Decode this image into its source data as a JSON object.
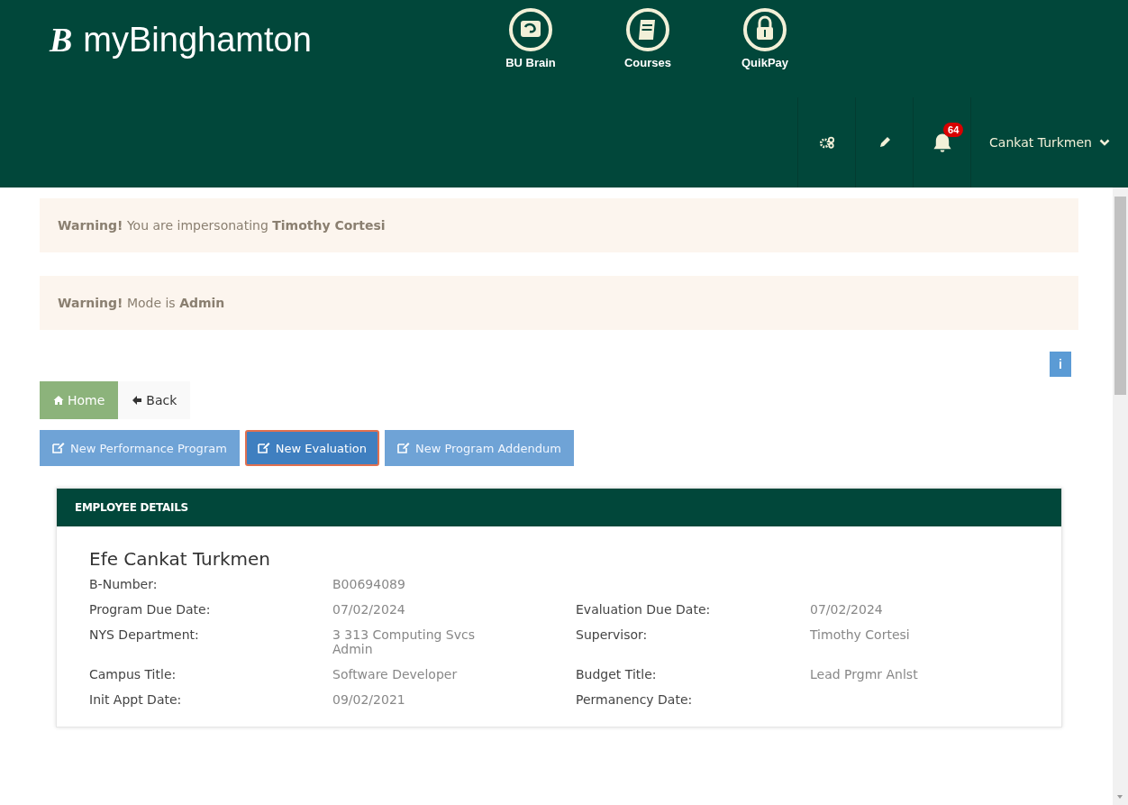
{
  "header": {
    "logo_letter": "B",
    "site_name": "myBinghamton",
    "quick_links": [
      {
        "label": "BU Brain",
        "kind": "brain"
      },
      {
        "label": "Courses",
        "kind": "book"
      },
      {
        "label": "QuikPay",
        "kind": "lock"
      }
    ],
    "notification_count": "64",
    "user_name": "Cankat Turkmen"
  },
  "alerts": [
    {
      "text": "**Warning!** You are impersonating **Timothy Cortesi**"
    },
    {
      "text": "**Warning!** Mode is **Admin**"
    }
  ],
  "info_button": "i",
  "nav_buttons": [
    {
      "label": "Home",
      "kind": "home"
    },
    {
      "label": "Back",
      "kind": "back"
    }
  ],
  "action_buttons": [
    {
      "label": "New Performance Program",
      "selected": false
    },
    {
      "label": "New Evaluation",
      "selected": true
    },
    {
      "label": "New Program Addendum",
      "selected": false
    }
  ],
  "panel": {
    "title": "EMPLOYEE DETAILS",
    "employee_name": "Efe Cankat Turkmen",
    "rows": [
      [
        {
          "label": "B-Number:",
          "value": "B00694089"
        }
      ],
      [
        {
          "label": "Program Due Date:",
          "value": "07/02/2024"
        },
        {
          "label": "Evaluation Due Date:",
          "value": "07/02/2024"
        }
      ],
      [
        {
          "label": "NYS Department:",
          "value": "3 313 Computing Svcs Admin"
        },
        {
          "label": "Supervisor:",
          "value": "Timothy Cortesi"
        }
      ],
      [
        {
          "label": "Campus Title:",
          "value": "Software Developer"
        },
        {
          "label": "Budget Title:",
          "value": "Lead Prgmr Anlst"
        }
      ],
      [
        {
          "label": "Init Appt Date:",
          "value": "09/02/2021"
        },
        {
          "label": "Permanency Date:"
        }
      ]
    ]
  }
}
